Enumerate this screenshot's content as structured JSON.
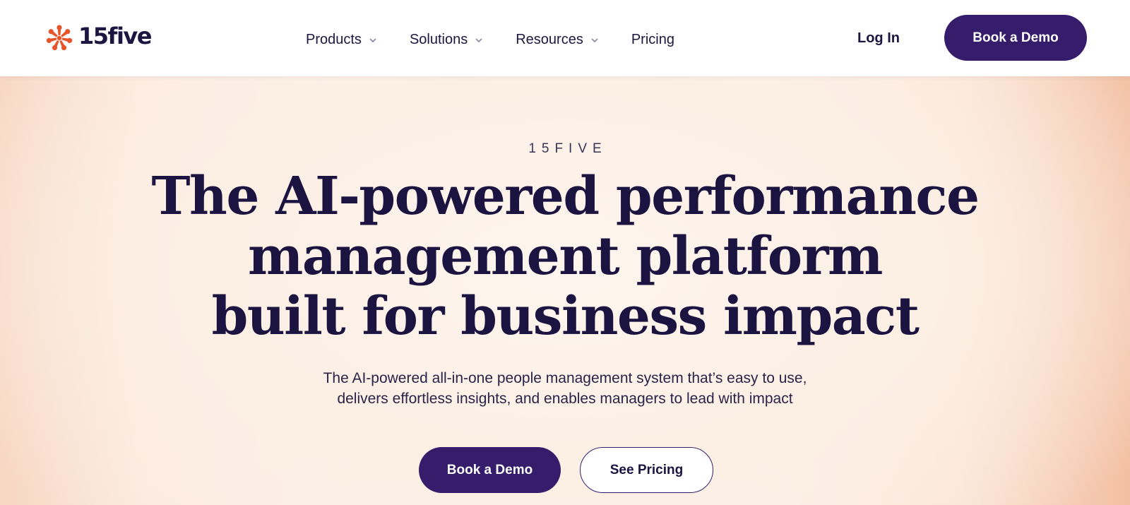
{
  "brand": {
    "name": "15five",
    "logo_icon": "starburst-logo-icon",
    "logo_color": "#e8542a"
  },
  "nav": {
    "items": [
      {
        "label": "Products",
        "has_dropdown": true,
        "icon": "chevron-down-icon"
      },
      {
        "label": "Solutions",
        "has_dropdown": true,
        "icon": "chevron-down-icon"
      },
      {
        "label": "Resources",
        "has_dropdown": true,
        "icon": "chevron-down-icon"
      },
      {
        "label": "Pricing",
        "has_dropdown": false
      }
    ],
    "login_label": "Log In",
    "demo_label": "Book a Demo"
  },
  "hero": {
    "eyebrow": "15FIVE",
    "headline_lines": [
      "The AI-powered performance",
      "management platform",
      "built for business impact"
    ],
    "subtext_lines": [
      "The AI-powered all-in-one people management system that’s easy to use,",
      "delivers effortless insights, and enables managers to lead with impact"
    ],
    "primary_cta": "Book a Demo",
    "secondary_cta": "See Pricing"
  },
  "colors": {
    "primary": "#351d6b",
    "text": "#1b1340",
    "accent": "#e8542a",
    "hero_bg": "#fdf3ec"
  }
}
